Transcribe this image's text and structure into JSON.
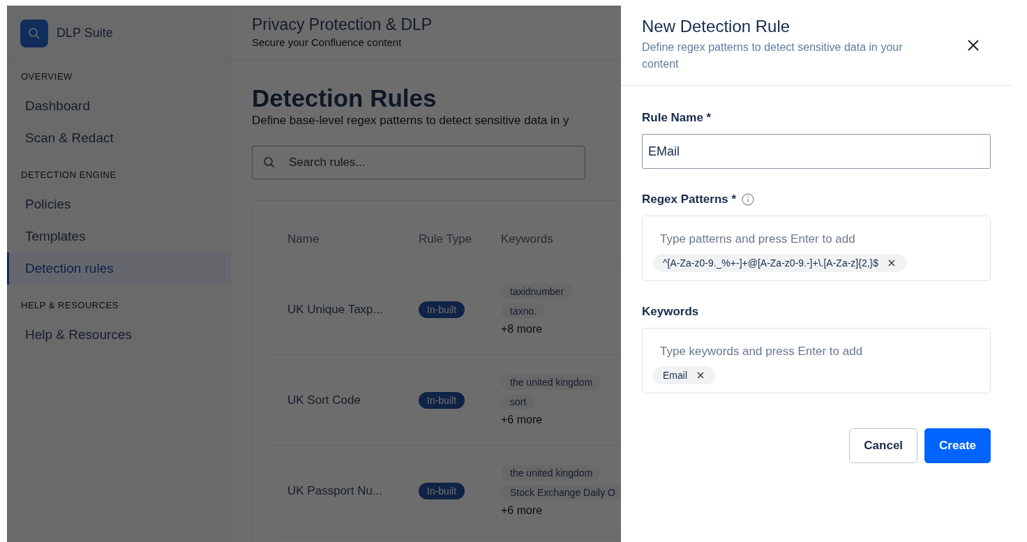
{
  "sidebar": {
    "brand": "DLP Suite",
    "sections": [
      {
        "title": "OVERVIEW",
        "items": [
          {
            "label": "Dashboard",
            "selected": false
          },
          {
            "label": "Scan & Redact",
            "selected": false
          }
        ]
      },
      {
        "title": "DETECTION ENGINE",
        "items": [
          {
            "label": "Policies",
            "selected": false
          },
          {
            "label": "Templates",
            "selected": false
          },
          {
            "label": "Detection rules",
            "selected": true
          }
        ]
      },
      {
        "title": "HELP & RESOURCES",
        "items": [
          {
            "label": "Help & Resources",
            "selected": false
          }
        ]
      }
    ]
  },
  "header": {
    "title": "Privacy Protection & DLP",
    "subtitle": "Secure your Confluence content"
  },
  "page": {
    "title": "Detection Rules",
    "description": "Define base-level regex patterns to detect sensitive data in y",
    "search": {
      "placeholder": "Search rules..."
    }
  },
  "table": {
    "columns": [
      "Name",
      "Rule Type",
      "Keywords"
    ],
    "rows": [
      {
        "name": "UK Unique Taxp...",
        "type": "In-built",
        "keywords": [
          "taxidnumber",
          "taxno."
        ],
        "more": "+8 more"
      },
      {
        "name": "UK Sort Code",
        "type": "In-built",
        "keywords": [
          "the united kingdom",
          "sort"
        ],
        "more": "+6 more"
      },
      {
        "name": "UK Passport Nu...",
        "type": "In-built",
        "keywords": [
          "the united kingdom",
          "Stock Exchange Daily O"
        ],
        "more": "+6 more"
      }
    ]
  },
  "drawer": {
    "title": "New Detection Rule",
    "subtitle": "Define regex patterns to detect sensitive data in your content",
    "fields": [
      {
        "kind": "text",
        "label": "Rule Name *",
        "value": "EMail"
      },
      {
        "kind": "tags",
        "label": "Regex Patterns *",
        "info": true,
        "placeholder": "Type patterns and press Enter to add",
        "tags": [
          "^[A-Za-z0-9._%+-]+@[A-Za-z0-9.-]+\\.[A-Za-z]{2,}$"
        ]
      },
      {
        "kind": "tags",
        "label": "Keywords",
        "info": false,
        "placeholder": "Type keywords and press Enter to add",
        "tags": [
          "Email"
        ]
      }
    ],
    "buttons": [
      {
        "label": "Cancel",
        "kind": "secondary"
      },
      {
        "label": "Create",
        "kind": "primary"
      }
    ]
  }
}
